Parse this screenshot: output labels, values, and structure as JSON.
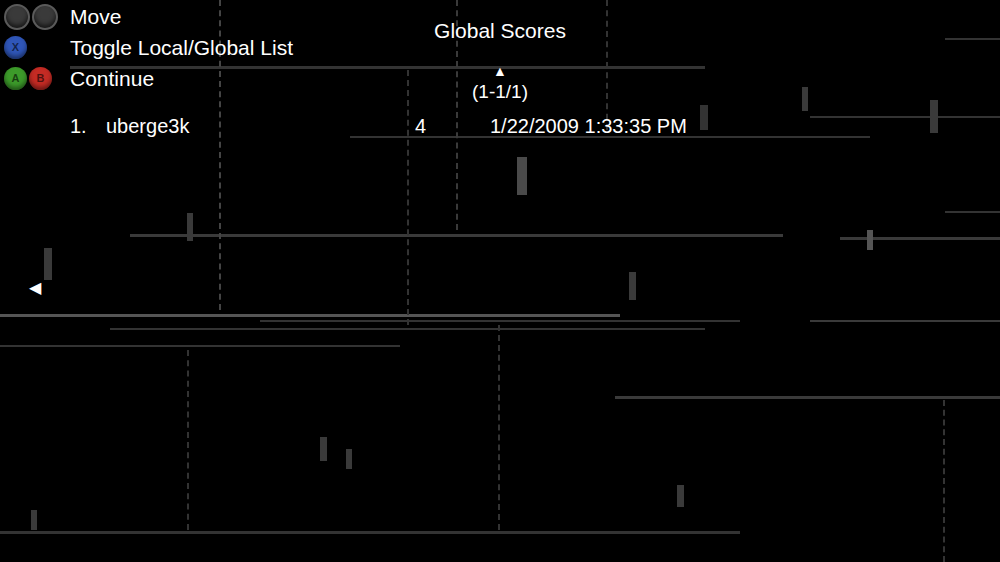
{
  "controls": [
    {
      "label": "Move",
      "buttons": [
        {
          "kind": "stick",
          "color": "#3a3a3a"
        },
        {
          "kind": "stick",
          "color": "#3a3a3a"
        }
      ]
    },
    {
      "label": "Toggle Local/Global List",
      "buttons": [
        {
          "kind": "face",
          "glyph": "X",
          "color": "#2f56b8"
        }
      ]
    },
    {
      "label": "Continue",
      "buttons": [
        {
          "kind": "face",
          "glyph": "A",
          "color": "#3c9a2a"
        },
        {
          "kind": "face",
          "glyph": "B",
          "color": "#c42b24"
        }
      ]
    }
  ],
  "header": {
    "title": "Global Scores",
    "scroll_up": "▲",
    "range": "(1-1/1)"
  },
  "scores": [
    {
      "rank": "1.",
      "name": "uberge3k",
      "score": "4",
      "date": "1/22/2009 1:33:35 PM",
      "selected": false
    }
  ],
  "back_arrow": "◀"
}
